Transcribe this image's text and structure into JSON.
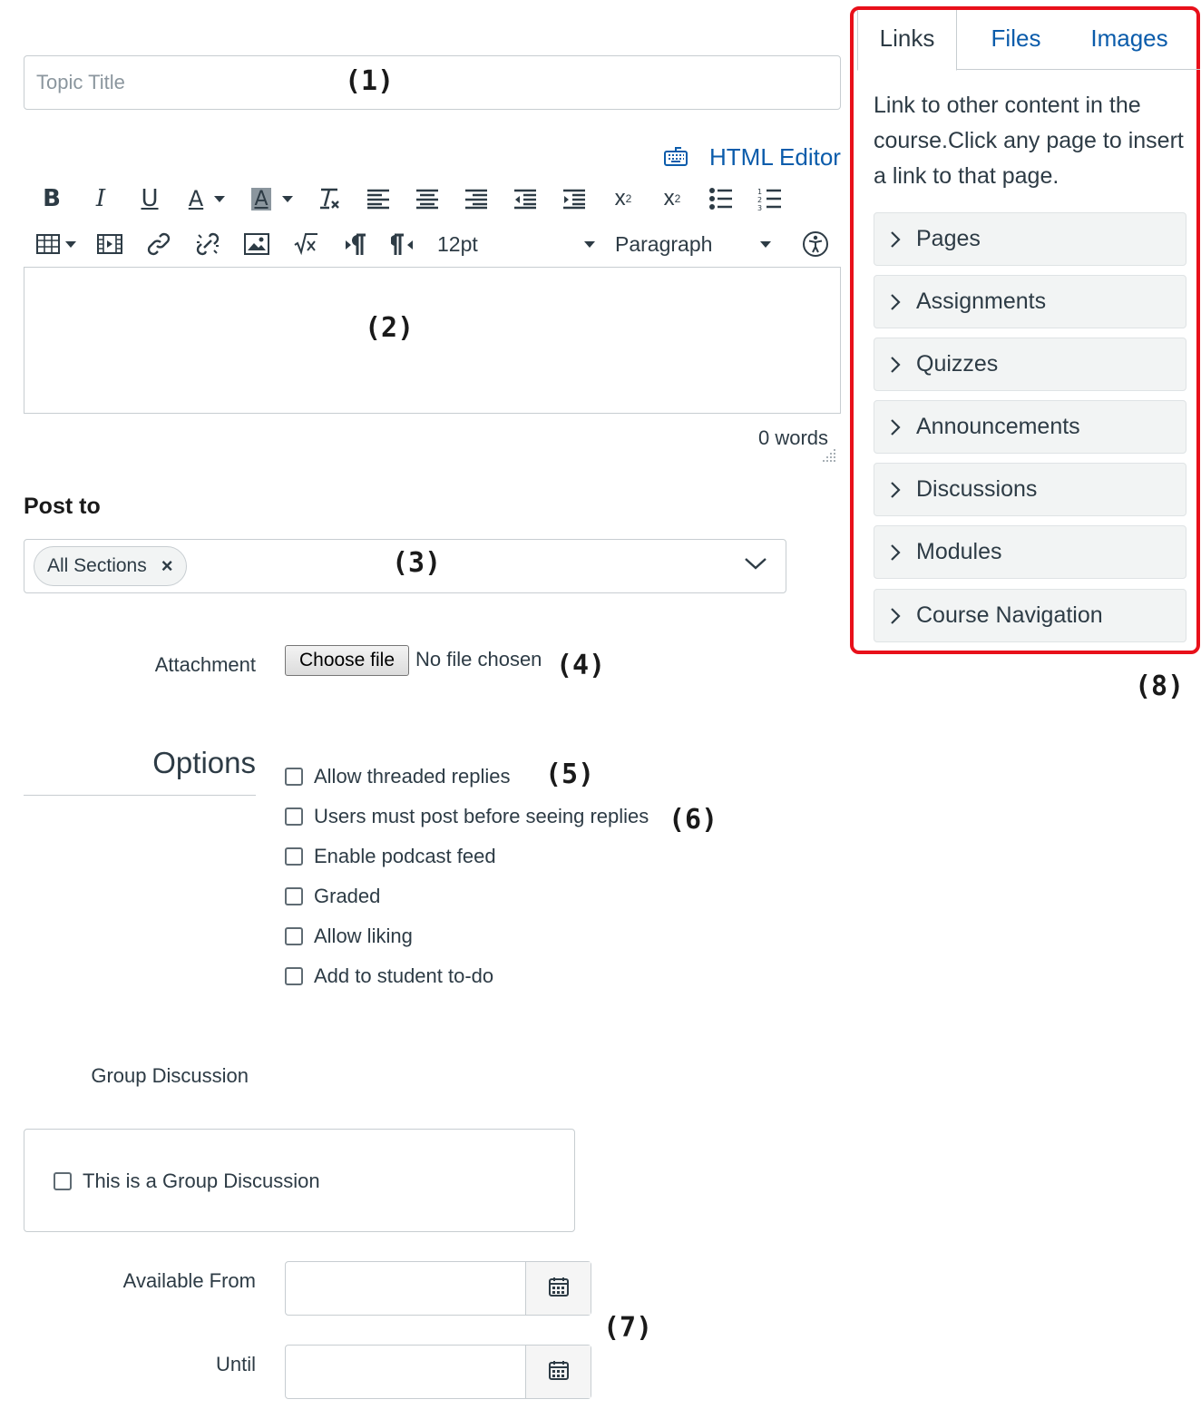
{
  "topic": {
    "placeholder": "Topic Title"
  },
  "editor": {
    "html_editor_label": "HTML Editor",
    "font_size": "12pt",
    "block_format": "Paragraph",
    "word_count": "0 words",
    "toolbar_icons": [
      "bold-icon",
      "italic-icon",
      "underline-icon",
      "text-color-icon",
      "background-color-icon",
      "clear-formatting-icon",
      "align-left-icon",
      "align-center-icon",
      "align-right-icon",
      "outdent-icon",
      "indent-icon",
      "superscript-icon",
      "subscript-icon",
      "bulleted-list-icon",
      "numbered-list-icon",
      "table-icon",
      "media-icon",
      "link-icon",
      "unlink-icon",
      "image-icon",
      "equation-icon",
      "ltr-icon",
      "rtl-icon",
      "accessibility-icon"
    ]
  },
  "post_to": {
    "label": "Post to",
    "selected_chip": "All Sections",
    "chip_remove": "×"
  },
  "attachment": {
    "label": "Attachment",
    "button": "Choose file",
    "status": "No file chosen"
  },
  "options": {
    "heading": "Options",
    "items": [
      {
        "label": "Allow threaded replies",
        "checked": false
      },
      {
        "label": "Users must post before seeing replies",
        "checked": false
      },
      {
        "label": "Enable podcast feed",
        "checked": false
      },
      {
        "label": "Graded",
        "checked": false
      },
      {
        "label": "Allow liking",
        "checked": false
      },
      {
        "label": "Add to student to-do",
        "checked": false
      }
    ]
  },
  "group": {
    "heading": "Group Discussion",
    "checkbox_label": "This is a Group Discussion"
  },
  "dates": {
    "available_from_label": "Available From",
    "until_label": "Until"
  },
  "panel": {
    "tabs": [
      "Links",
      "Files",
      "Images"
    ],
    "active_tab": "Links",
    "description": "Link to other content in the course.Click any page to insert a link to that page.",
    "sections": [
      "Pages",
      "Assignments",
      "Quizzes",
      "Announcements",
      "Discussions",
      "Modules",
      "Course Navigation"
    ],
    "border_color": "#e8101a"
  },
  "callouts": [
    "(1)",
    "(2)",
    "(3)",
    "(4)",
    "(5)",
    "(6)",
    "(7)",
    "(8)"
  ],
  "colors": {
    "link": "#0b5cab",
    "text": "#2d3b45",
    "border": "#c7cdd1"
  }
}
